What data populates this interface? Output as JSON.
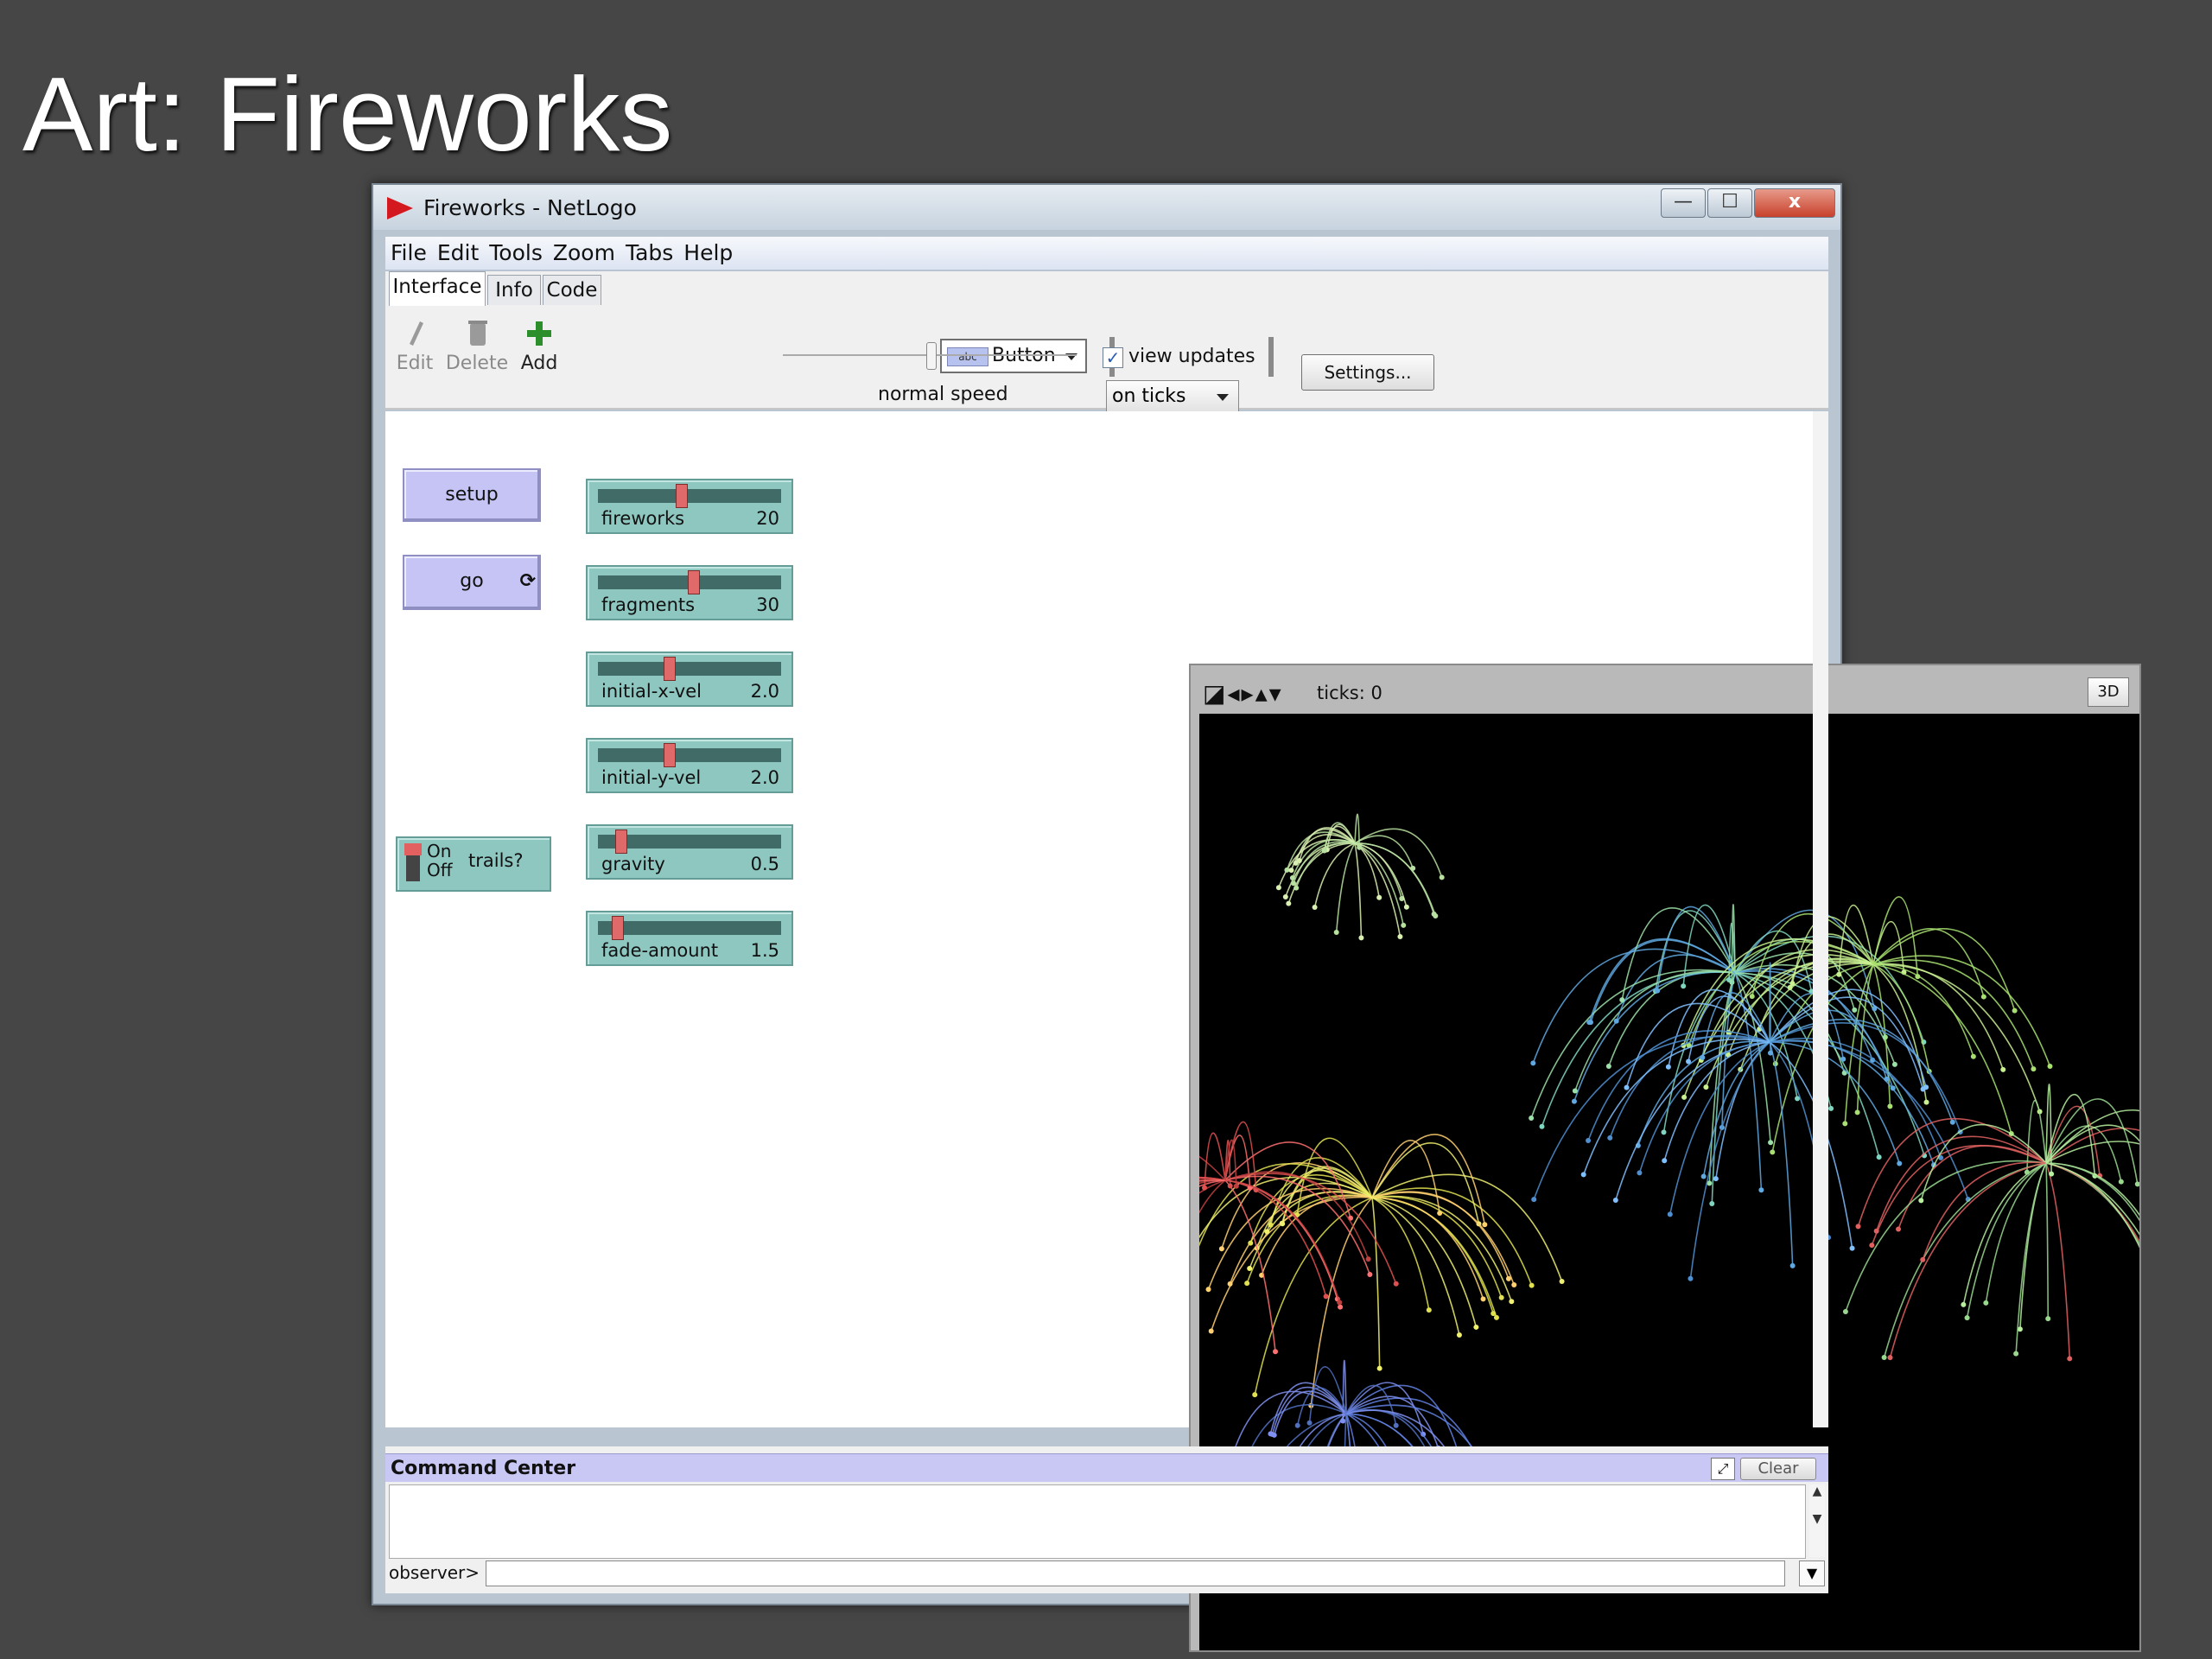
{
  "slide": {
    "title": "Art: Fireworks"
  },
  "window": {
    "title": "Fireworks - NetLogo",
    "minimize": "—",
    "maximize": "☐",
    "close": "x"
  },
  "menu": [
    "File",
    "Edit",
    "Tools",
    "Zoom",
    "Tabs",
    "Help"
  ],
  "tabs": [
    "Interface",
    "Info",
    "Code"
  ],
  "toolbar": {
    "edit": "Edit",
    "delete": "Delete",
    "add": "Add",
    "widget_type": "Button",
    "widget_chip": "abc",
    "speed_label": "normal speed",
    "speed": 0.5,
    "view_updates": "view updates",
    "view_updates_checked": true,
    "update_mode": "on ticks",
    "settings": "Settings..."
  },
  "widgets": {
    "setup": "setup",
    "go": "go",
    "forever_icon": "forever-loop-icon",
    "trails_switch": {
      "on": "On",
      "off": "Off",
      "label": "trails?",
      "state": "off"
    },
    "sliders": [
      {
        "label": "fireworks",
        "value": "20",
        "fraction": 0.45
      },
      {
        "label": "fragments",
        "value": "30",
        "fraction": 0.52
      },
      {
        "label": "initial-x-vel",
        "value": "2.0",
        "fraction": 0.38
      },
      {
        "label": "initial-y-vel",
        "value": "2.0",
        "fraction": 0.38
      },
      {
        "label": "gravity",
        "value": "0.5",
        "fraction": 0.1
      },
      {
        "label": "fade-amount",
        "value": "1.5",
        "fraction": 0.08
      }
    ]
  },
  "view": {
    "ticks": "ticks: 0",
    "btn3d": "3D"
  },
  "command_center": {
    "title": "Command Center",
    "clear": "Clear",
    "prompt": "observer>"
  },
  "colors": {
    "button": "#c5c4f4",
    "slider": "#8ec6c0",
    "world": "#000000"
  }
}
